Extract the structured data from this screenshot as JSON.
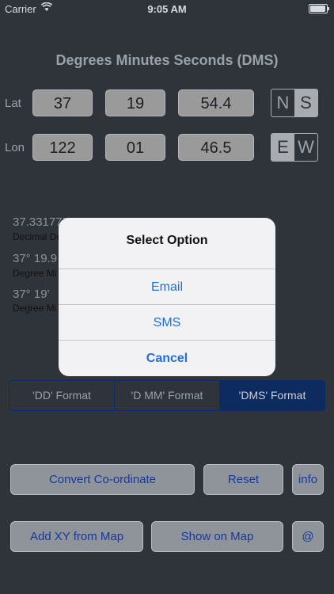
{
  "status_bar": {
    "carrier": "Carrier",
    "time": "9:05 AM",
    "battery_level": 0.95
  },
  "title": "Degrees Minutes Seconds (DMS)",
  "lat": {
    "label": "Lat",
    "deg": "37",
    "min": "19",
    "sec": "54.4",
    "hemi": [
      "N",
      "S"
    ],
    "selected": "S"
  },
  "lon": {
    "label": "Lon",
    "deg": "122",
    "min": "01",
    "sec": "46.5",
    "hemi": [
      "E",
      "W"
    ],
    "selected": "E"
  },
  "results": [
    {
      "value": "37.331777, -122.029583",
      "label": "Decimal Degrees"
    },
    {
      "value": "37° 19.9",
      "label": "Degree Mi"
    },
    {
      "value": "37° 19'",
      "label": "Degree Mi"
    }
  ],
  "formats": [
    "'DD' Format",
    "'D MM' Format",
    "'DMS' Format"
  ],
  "selected_format": "'DMS' Format",
  "buttons": {
    "convert": "Convert Co-ordinate",
    "reset": "Reset",
    "info": "info",
    "add_xy": "Add XY from Map",
    "show_map": "Show on Map",
    "at": "@"
  },
  "alert": {
    "title": "Select Option",
    "options": [
      "Email",
      "SMS",
      "Cancel"
    ]
  }
}
